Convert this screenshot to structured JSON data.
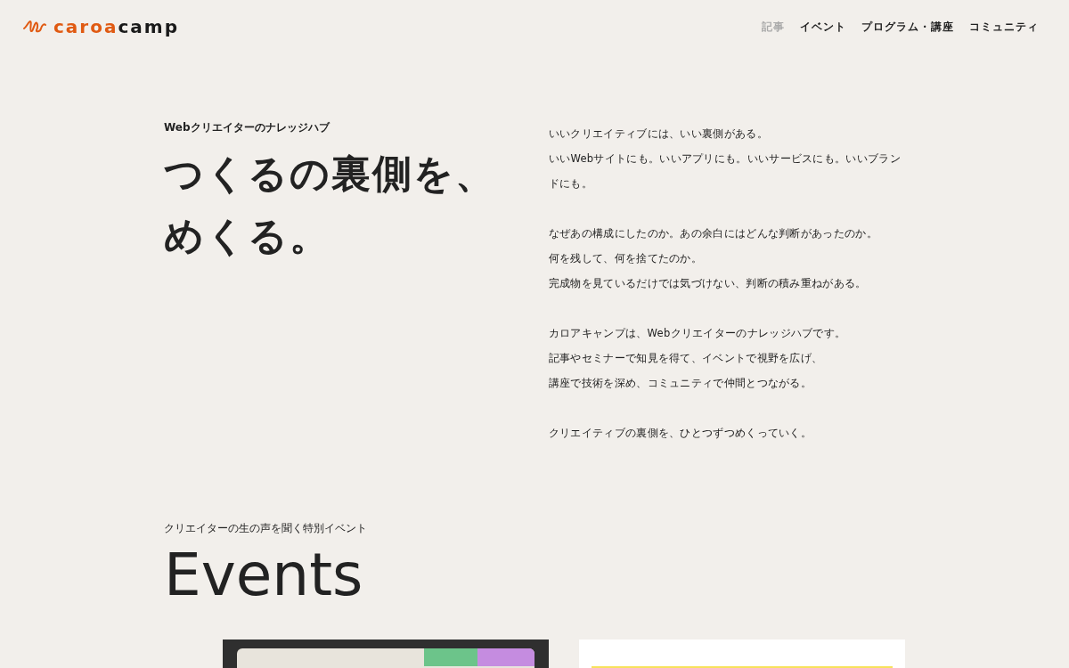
{
  "header": {
    "logo": {
      "part1": "caroa",
      "part2": "camp"
    },
    "nav": [
      {
        "label": "記事",
        "selected": true
      },
      {
        "label": "イベント",
        "selected": false
      },
      {
        "label": "プログラム・講座",
        "selected": false
      },
      {
        "label": "コミュニティ",
        "selected": false
      }
    ]
  },
  "hero": {
    "eyebrow": "Webクリエイターのナレッジハブ",
    "title_lines": [
      "つくるの裏側を、",
      "めくる。"
    ],
    "paragraphs": [
      [
        "いいクリエイティブには、いい裏側がある。",
        "いいWebサイトにも。いいアプリにも。いいサービスにも。いいブランドにも。"
      ],
      [
        "なぜあの構成にしたのか。あの余白にはどんな判断があったのか。",
        "何を残して、何を捨てたのか。",
        "完成物を見ているだけでは気づけない、判断の積み重ねがある。"
      ],
      [
        "カロアキャンプは、Webクリエイターのナレッジハブです。",
        "記事やセミナーで知見を得て、イベントで視野を広げ、",
        "講座で技術を深め、コミュニティで仲間とつながる。"
      ],
      [
        "クリエイティブの裏側を、ひとつずつめくっていく。"
      ]
    ]
  },
  "events": {
    "eyebrow": "クリエイターの生の声を聞く特別イベント",
    "title": "Events",
    "cards": [
      {
        "kind": "dark"
      },
      {
        "kind": "light"
      }
    ]
  }
}
